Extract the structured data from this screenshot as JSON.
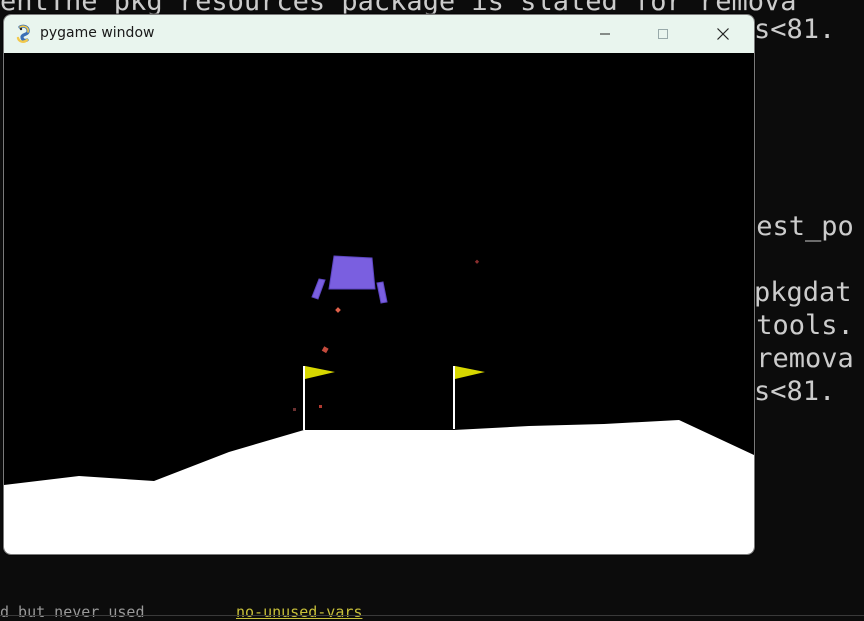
{
  "window": {
    "title": "pygame window",
    "controls": [
      "minimize",
      "maximize",
      "close"
    ],
    "icon": "pygame-snake-icon"
  },
  "game": {
    "environment": "lunar-lander",
    "lander_color": "#7a5fe0",
    "flag_color": "#d7d700",
    "terrain_color": "#ffffff",
    "sky_color": "#000000",
    "particle_color": "#d04a3a"
  },
  "terminal": {
    "lines": [
      "The pkg_resources package is slated for remova",
      "s<81.",
      "best_po",
      "pkgdat",
      "ptools.",
      " remova",
      "s<81."
    ],
    "footer_left": "d but never used",
    "footer_link": "no-unused-vars",
    "underlined_word": "ent"
  }
}
